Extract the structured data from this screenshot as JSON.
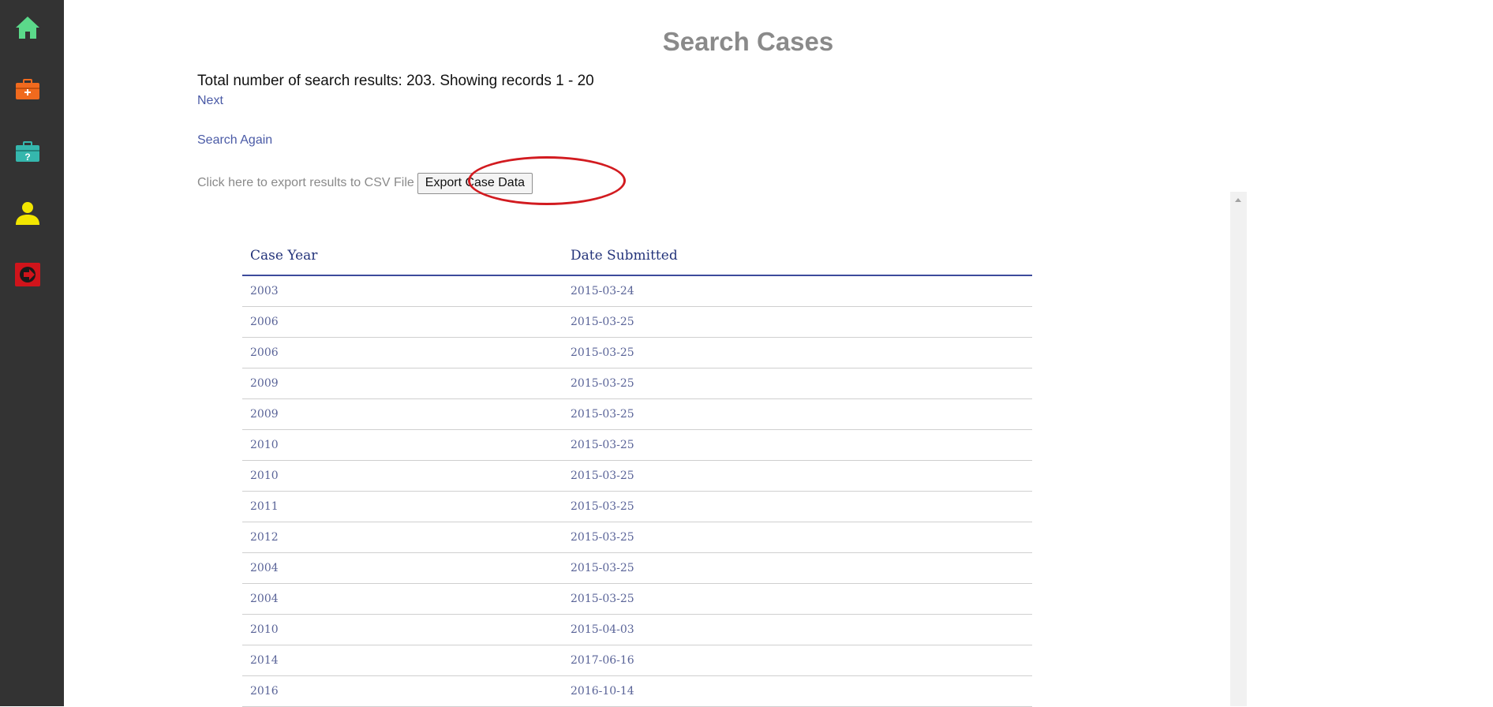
{
  "sidebar": {
    "items": [
      {
        "name": "home",
        "icon": "home-icon",
        "color": "#5bd98a"
      },
      {
        "name": "add-case",
        "icon": "medical-kit-plus-icon",
        "color": "#f06a1e"
      },
      {
        "name": "help",
        "icon": "medical-kit-question-icon",
        "color": "#35b7ad"
      },
      {
        "name": "profile",
        "icon": "user-icon",
        "color": "#f2e600"
      },
      {
        "name": "logout",
        "icon": "logout-icon",
        "color": "#d0141b"
      }
    ]
  },
  "page": {
    "title": "Search Cases",
    "summary": "Total number of search results: 203. Showing records 1 - 20",
    "next_label": "Next",
    "search_again_label": "Search Again",
    "export_label": "Click here to export results to CSV File",
    "export_button_label": "Export Case Data"
  },
  "table": {
    "columns": [
      "Case Year",
      "Date Submitted"
    ],
    "rows": [
      [
        "2003",
        "2015-03-24"
      ],
      [
        "2006",
        "2015-03-25"
      ],
      [
        "2006",
        "2015-03-25"
      ],
      [
        "2009",
        "2015-03-25"
      ],
      [
        "2009",
        "2015-03-25"
      ],
      [
        "2010",
        "2015-03-25"
      ],
      [
        "2010",
        "2015-03-25"
      ],
      [
        "2011",
        "2015-03-25"
      ],
      [
        "2012",
        "2015-03-25"
      ],
      [
        "2004",
        "2015-03-25"
      ],
      [
        "2004",
        "2015-03-25"
      ],
      [
        "2010",
        "2015-04-03"
      ],
      [
        "2014",
        "2017-06-16"
      ],
      [
        "2016",
        "2016-10-14"
      ]
    ]
  },
  "colors": {
    "sidebar_bg": "#333333",
    "link": "#4a5aa6",
    "highlight": "#d21b20",
    "header_text": "#23337a"
  }
}
